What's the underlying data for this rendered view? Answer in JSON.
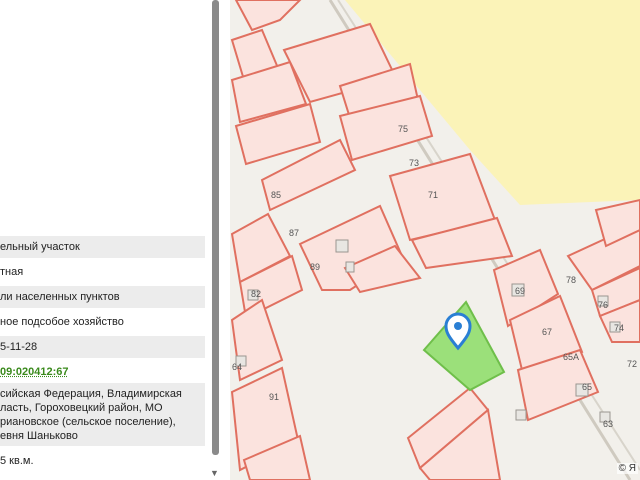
{
  "details": {
    "rows": [
      {
        "text": "ельный участок"
      },
      {
        "text": "тная"
      },
      {
        "text": "ли населенных пунктов"
      },
      {
        "text": "ное подсобое хозяйство"
      },
      {
        "text": "5-11-28"
      },
      {
        "text": "09:020412:67"
      },
      {
        "text": "сийская Федерация, Владимирская ласть, Гороховецкий район, МО риановское (сельское поселение), евня Шанькoво"
      },
      {
        "text": "5 кв.м."
      }
    ]
  },
  "map": {
    "plot_numbers": [
      "75",
      "73",
      "71",
      "85",
      "87",
      "89",
      "82",
      "69",
      "78",
      "76",
      "74",
      "72",
      "67",
      "65А",
      "65",
      "63",
      "91",
      "64"
    ],
    "attribution": "© Я",
    "colors": {
      "parcel_fill": "#fbe3de",
      "parcel_stroke": "#e07060",
      "selected_fill": "#9be07a",
      "selected_stroke": "#6fbf4a",
      "forest_fill": "#fbf3b8",
      "pin": "#2a7fd4"
    }
  }
}
